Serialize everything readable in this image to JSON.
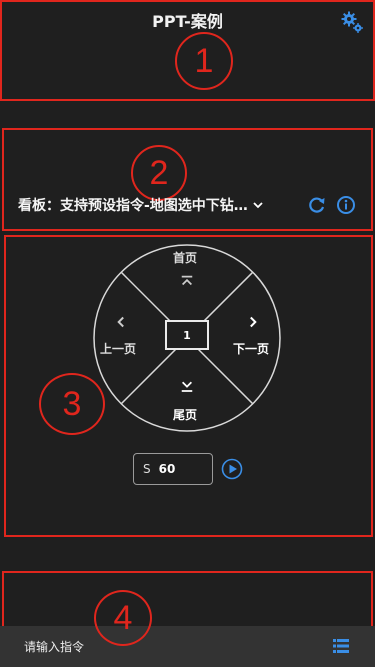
{
  "app": {
    "title": "PPT-案例"
  },
  "annotations": {
    "n1": "1",
    "n2": "2",
    "n3": "3",
    "n4": "4"
  },
  "board": {
    "label": "看板：支持预设指令-地图选中下钻…"
  },
  "pager": {
    "first": "首页",
    "prev": "上一页",
    "next": "下一页",
    "last": "尾页",
    "current_page": "1"
  },
  "interval": {
    "prefix": "S",
    "value": "60"
  },
  "command": {
    "placeholder": "请输入指令"
  },
  "colors": {
    "accent": "#3a8ee6",
    "annotation_red": "#e0261d",
    "background": "#1f1f1f"
  },
  "icons": [
    "gear-icon",
    "chevron-down-icon",
    "refresh-icon",
    "info-icon",
    "play-icon",
    "list-icon"
  ]
}
